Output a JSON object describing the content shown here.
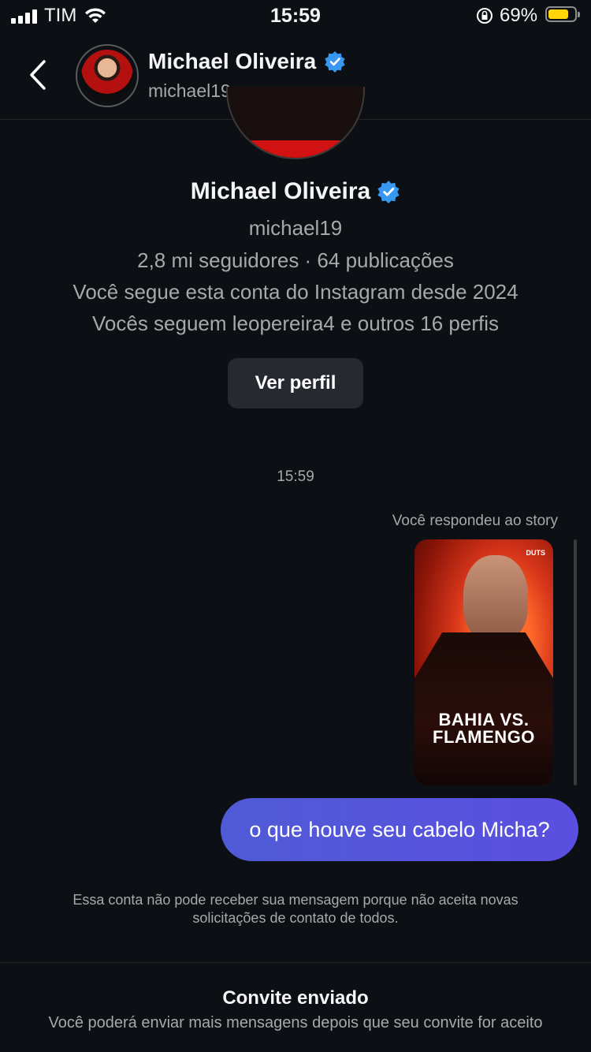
{
  "status_bar": {
    "carrier": "TIM",
    "time": "15:59",
    "battery_percent": "69%"
  },
  "header": {
    "name": "Michael Oliveira",
    "username": "michael19"
  },
  "profile": {
    "name": "Michael Oliveira",
    "username": "michael19",
    "stats": "2,8 mi seguidores · 64 publicações",
    "follow_since": "Você segue esta conta do Instagram desde 2024",
    "mutuals": "Vocês seguem leopereira4 e outros 16 perfis",
    "view_profile_label": "Ver perfil"
  },
  "conversation": {
    "timestamp": "15:59",
    "story_reply_label": "Você respondeu ao story",
    "story": {
      "logo": "DUTS",
      "headline_1": "BAHIA VS.",
      "headline_2": "FLAMENGO"
    },
    "message": "o que houve seu cabelo Micha?"
  },
  "notice": "Essa conta não pode receber sua mensagem porque não aceita novas solicitações de contato de todos.",
  "invite": {
    "title": "Convite enviado",
    "text": "Você poderá enviar mais mensagens depois que seu convite for aceito"
  },
  "colors": {
    "background": "#0c1014",
    "bubble": "#5851db",
    "verified": "#3897f0",
    "battery": "#ffd60a"
  }
}
